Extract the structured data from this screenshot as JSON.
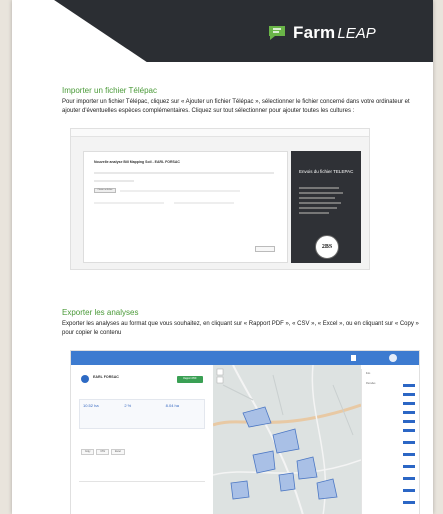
{
  "brand": {
    "name_bold": "Farm",
    "name_light": "LEAP",
    "accent": "#4a9a38",
    "header_bg": "#2b2e33"
  },
  "section1": {
    "title": "Importer un fichier Télépac",
    "text": "Pour importer un fichier Télépac, cliquez sur « Ajouter un fichier Télépac », sélectionner le fichier concerné dans votre ordinateur et ajouter d'éventuelles espèces complémentaires. Cliquez sur tout sélectionner pour ajouter toutes les cultures :"
  },
  "shot1": {
    "modal_title": "Nouvelle analyse Bill Mapping Soil - EARL FORSAC",
    "file_button": "Choisir un fichier",
    "side_title": "Envois du fichier TELEPAC",
    "badge": "2BS"
  },
  "section2": {
    "title": "Exporter les analyses",
    "text": "Exporter les analyses au format que vous souhaitez, en cliquant sur « Rapport PDF », « CSV », « Excel », ou en cliquant sur « Copy » pour copier le contenu"
  },
  "shot2": {
    "farm_name": "EARL FORSAC",
    "green_button": "Rapport PDF",
    "stats": [
      {
        "value": "10.52 ha"
      },
      {
        "value": "2 %"
      },
      {
        "value": "8.04 ha"
      }
    ],
    "export_buttons": [
      "Copy",
      "CSV",
      "Excel"
    ],
    "legend_items": [
      "Ilots",
      "Parcelles",
      "",
      "",
      "",
      "",
      "",
      "",
      "",
      "",
      "",
      "",
      ""
    ]
  }
}
